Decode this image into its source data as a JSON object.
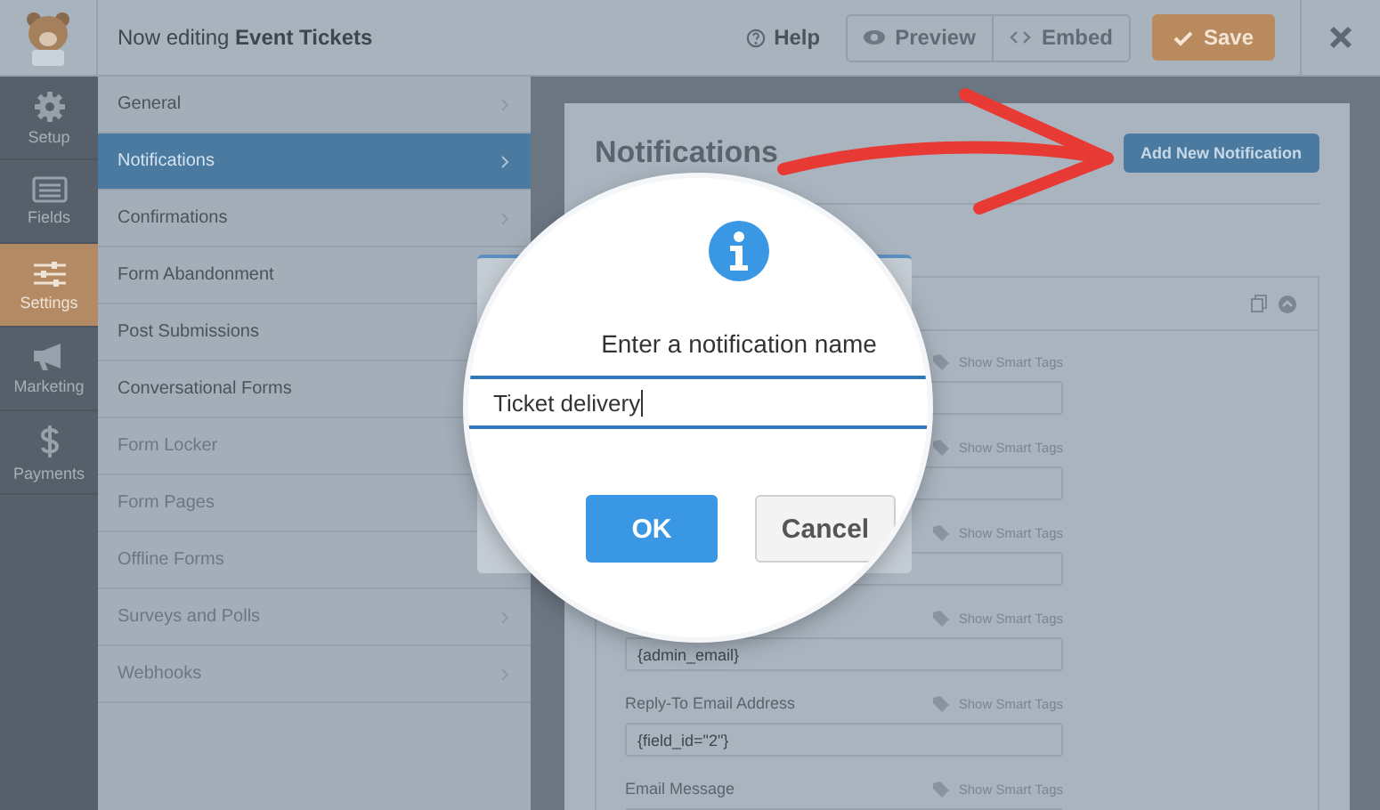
{
  "topbar": {
    "title": "Now editing **Event Tickets**",
    "help": "Help",
    "preview": "Preview",
    "embed": "Embed",
    "save": "Save"
  },
  "sidebar": [
    {
      "kind": "setup",
      "label": "Setup",
      "selected": false
    },
    {
      "kind": "fields",
      "label": "Fields",
      "selected": false
    },
    {
      "kind": "settings",
      "label": "Settings",
      "selected": true
    },
    {
      "kind": "marketing",
      "label": "Marketing",
      "selected": false
    },
    {
      "kind": "payments",
      "label": "Payments",
      "selected": false
    }
  ],
  "settings_menu": [
    {
      "label": "General",
      "selected": false,
      "disabled": false
    },
    {
      "label": "Notifications",
      "selected": true,
      "disabled": false
    },
    {
      "label": "Confirmations",
      "selected": false,
      "disabled": false
    },
    {
      "label": "Form Abandonment",
      "selected": false,
      "disabled": false
    },
    {
      "label": "Post Submissions",
      "selected": false,
      "disabled": false
    },
    {
      "label": "Conversational Forms",
      "selected": false,
      "disabled": false
    },
    {
      "label": "Form Locker",
      "selected": false,
      "disabled": true
    },
    {
      "label": "Form Pages",
      "selected": false,
      "disabled": true
    },
    {
      "label": "Offline Forms",
      "selected": false,
      "disabled": true
    },
    {
      "label": "Surveys and Polls",
      "selected": false,
      "disabled": true
    },
    {
      "label": "Webhooks",
      "selected": false,
      "disabled": true
    }
  ],
  "panel": {
    "title": "Notifications",
    "add_button": "Add New Notification",
    "fields": [
      {
        "smart_tags": "Show Smart Tags"
      },
      {
        "smart_tags": "Show Smart Tags"
      },
      {
        "smart_tags": "Show Smart Tags"
      },
      {
        "smart_tags": "Show Smart Tags",
        "value": "{admin_email}"
      },
      {
        "label": "Reply-To Email Address",
        "smart_tags": "Show Smart Tags",
        "value": "{field_id=\"2\"}"
      },
      {
        "label": "Email Message",
        "smart_tags": "Show Smart Tags"
      }
    ]
  },
  "dialog": {
    "message": "Enter a notification name",
    "value": "Ticket delivery",
    "ok": "OK",
    "cancel": "Cancel"
  }
}
